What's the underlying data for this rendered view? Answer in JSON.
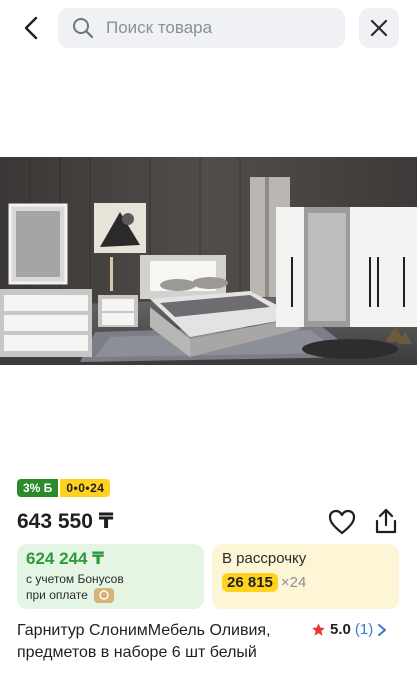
{
  "search": {
    "placeholder": "Поиск товара"
  },
  "product": {
    "image_alt": "Спальный гарнитур",
    "badges": {
      "bonus": "3% Б",
      "installment": "0•0•24"
    },
    "price": "643 550 ₸",
    "bonus_offer": {
      "price": "624 244 ₸",
      "note_line1": "с учетом Бонусов",
      "note_line2": "при оплате"
    },
    "installment": {
      "title": "В рассрочку",
      "amount": "26 815",
      "multiplier": "×24"
    },
    "title": "Гарнитур СлонимМебель Оливия, предметов в наборе 6 шт белый",
    "rating": {
      "value": "5.0",
      "count": "(1)"
    }
  },
  "colors": {
    "bonus_green": "#2c8a2c",
    "installment_yellow": "#ffd21f",
    "link_blue": "#3a78d0",
    "star_red": "#e53935"
  }
}
